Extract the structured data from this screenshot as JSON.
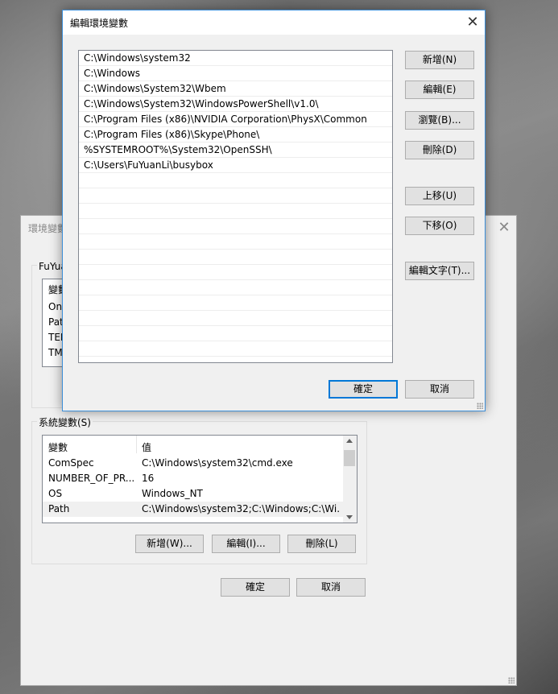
{
  "env_dialog": {
    "title": "環境變數",
    "user_group_label": "FuYuanLi 的使用者變數(U)",
    "user_col_var": "變數",
    "user_vars": [
      "OneDrive",
      "Path",
      "TEMP",
      "TMP"
    ],
    "system_group_label": "系統變數(S)",
    "system_columns": {
      "var": "變數",
      "val": "值"
    },
    "system_rows": [
      {
        "var": "ComSpec",
        "val": "C:\\Windows\\system32\\cmd.exe"
      },
      {
        "var": "NUMBER_OF_PR...",
        "val": "16"
      },
      {
        "var": "OS",
        "val": "Windows_NT"
      },
      {
        "var": "Path",
        "val": "C:\\Windows\\system32;C:\\Windows;C:\\Wi..."
      }
    ],
    "new_label": "新增(W)...",
    "edit_label": "編輯(I)...",
    "delete_label": "刪除(L)",
    "ok_label": "確定",
    "cancel_label": "取消",
    "close_glyph": "✕"
  },
  "edit_dialog": {
    "title": "編輯環境變數",
    "close_glyph": "✕",
    "paths": [
      "C:\\Windows\\system32",
      "C:\\Windows",
      "C:\\Windows\\System32\\Wbem",
      "C:\\Windows\\System32\\WindowsPowerShell\\v1.0\\",
      "C:\\Program Files (x86)\\NVIDIA Corporation\\PhysX\\Common",
      "C:\\Program Files (x86)\\Skype\\Phone\\",
      "%SYSTEMROOT%\\System32\\OpenSSH\\",
      "C:\\Users\\FuYuanLi\\busybox"
    ],
    "buttons": {
      "new": "新增(N)",
      "edit": "編輯(E)",
      "browse": "瀏覽(B)...",
      "delete": "刪除(D)",
      "move_up": "上移(U)",
      "move_down": "下移(O)",
      "edit_text": "編輯文字(T)...",
      "ok": "確定",
      "cancel": "取消"
    }
  }
}
